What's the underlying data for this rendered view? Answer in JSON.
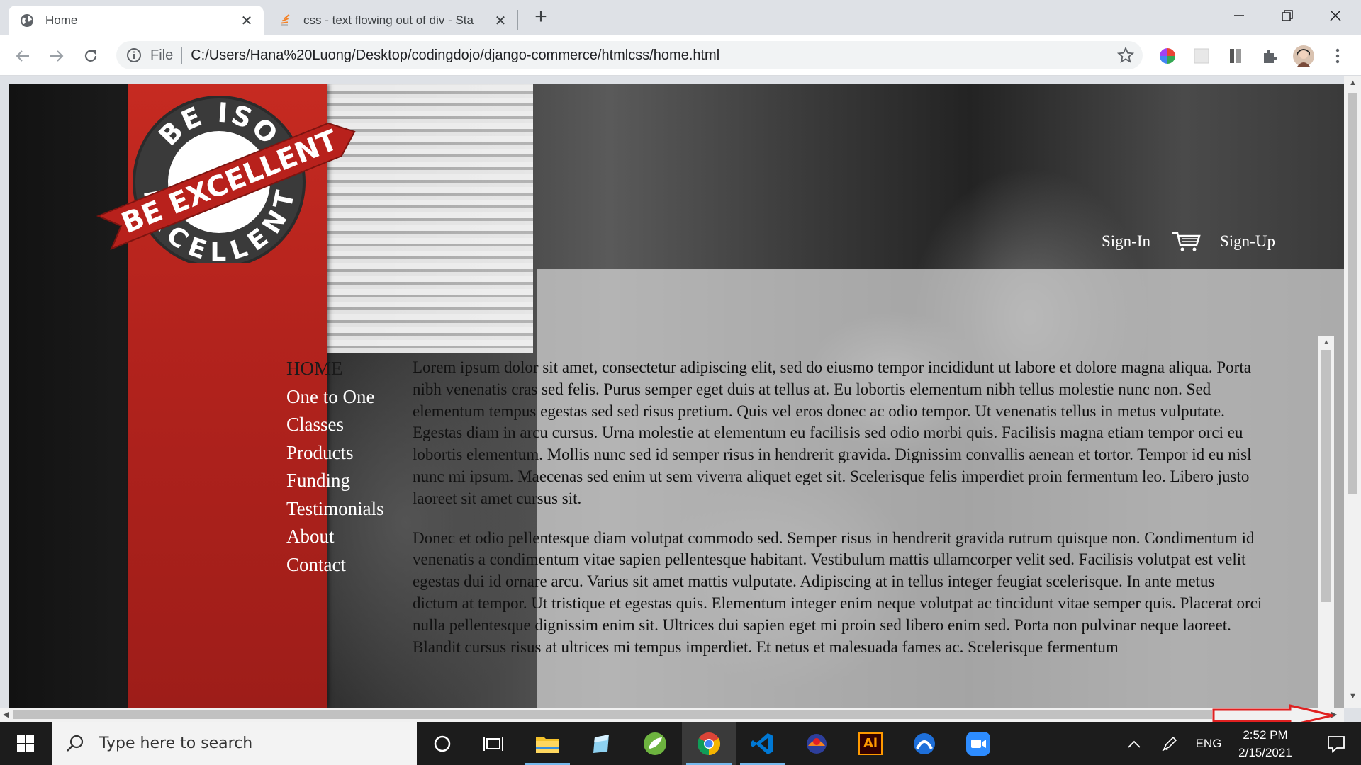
{
  "browser": {
    "tabs": [
      {
        "title": "Home",
        "active": true
      },
      {
        "title": "css - text flowing out of div - Sta",
        "active": false
      }
    ],
    "new_tab_symbol": "+",
    "close_symbol": "✕",
    "omnibox": {
      "scheme_label": "File",
      "url": "C:/Users/Hana%20Luong/Desktop/codingdojo/django-commerce/htmlcss/home.html"
    },
    "toolbar_icons": [
      "back-icon",
      "forward-icon",
      "reload-icon",
      "info-icon",
      "star-icon",
      "color-extension-icon",
      "puzzle-extension-icon",
      "profile-avatar"
    ]
  },
  "page": {
    "logo": {
      "top_text": "BE ISO",
      "ribbon_text": "BE EXCELLENT",
      "bottom_text": "EXCELLENT",
      "colors": {
        "ribbon": "#b8211c",
        "ring": "#3a3a3a"
      }
    },
    "nav": [
      "HOME",
      "One to One",
      "Classes",
      "Products",
      "Funding",
      "Testimonials",
      "About",
      "Contact"
    ],
    "top_links": {
      "sign_in": "Sign-In",
      "sign_up": "Sign-Up"
    },
    "article": {
      "paragraphs": [
        "Lorem ipsum dolor sit amet, consectetur adipiscing elit, sed do eiusmo tempor incididunt ut labore et dolore magna aliqua. Porta nibh venenatis cras sed felis. Purus semper eget duis at tellus at. Eu lobortis elementum nibh tellus molestie nunc non. Sed elementum tempus egestas sed sed risus pretium. Quis vel eros donec ac odio tempor. Ut venenatis tellus in metus vulputate. Egestas diam in arcu cursus. Urna molestie at elementum eu facilisis sed odio morbi quis. Facilisis magna etiam tempor orci eu lobortis elementum. Mollis nunc sed id semper risus in hendrerit gravida. Dignissim convallis aenean et tortor. Tempor id eu nisl nunc mi ipsum. Maecenas sed enim ut sem viverra aliquet eget sit. Scelerisque felis imperdiet proin fermentum leo. Libero justo laoreet sit amet cursus sit.",
        "Donec et odio pellentesque diam volutpat commodo sed. Semper risus in hendrerit gravida rutrum quisque non. Condimentum id venenatis a condimentum vitae sapien pellentesque habitant. Vestibulum mattis ullamcorper velit sed. Facilisis volutpat est velit egestas dui id ornare arcu. Varius sit amet mattis vulputate. Adipiscing at in tellus integer feugiat scelerisque. In ante metus dictum at tempor. Ut tristique et egestas quis. Elementum integer enim neque volutpat ac tincidunt vitae semper quis. Placerat orci nulla pellentesque dignissim enim sit. Ultrices dui sapien eget mi proin sed libero enim sed. Porta non pulvinar neque laoreet. Blandit cursus risus at ultrices mi tempus imperdiet. Et netus et malesuada fames ac. Scelerisque fermentum"
      ]
    },
    "annotation_arrow_color": "#e02020"
  },
  "taskbar": {
    "search_placeholder": "Type here to search",
    "apps": [
      "cortana-icon",
      "task-view-icon",
      "file-explorer-icon",
      "notepad-icon",
      "spring-tool-icon",
      "chrome-icon",
      "vscode-icon",
      "app-icon",
      "illustrator-icon",
      "arc-icon",
      "zoom-icon"
    ],
    "illustrator_label": "Ai",
    "language": "ENG",
    "time": "2:52 PM",
    "date": "2/15/2021"
  }
}
